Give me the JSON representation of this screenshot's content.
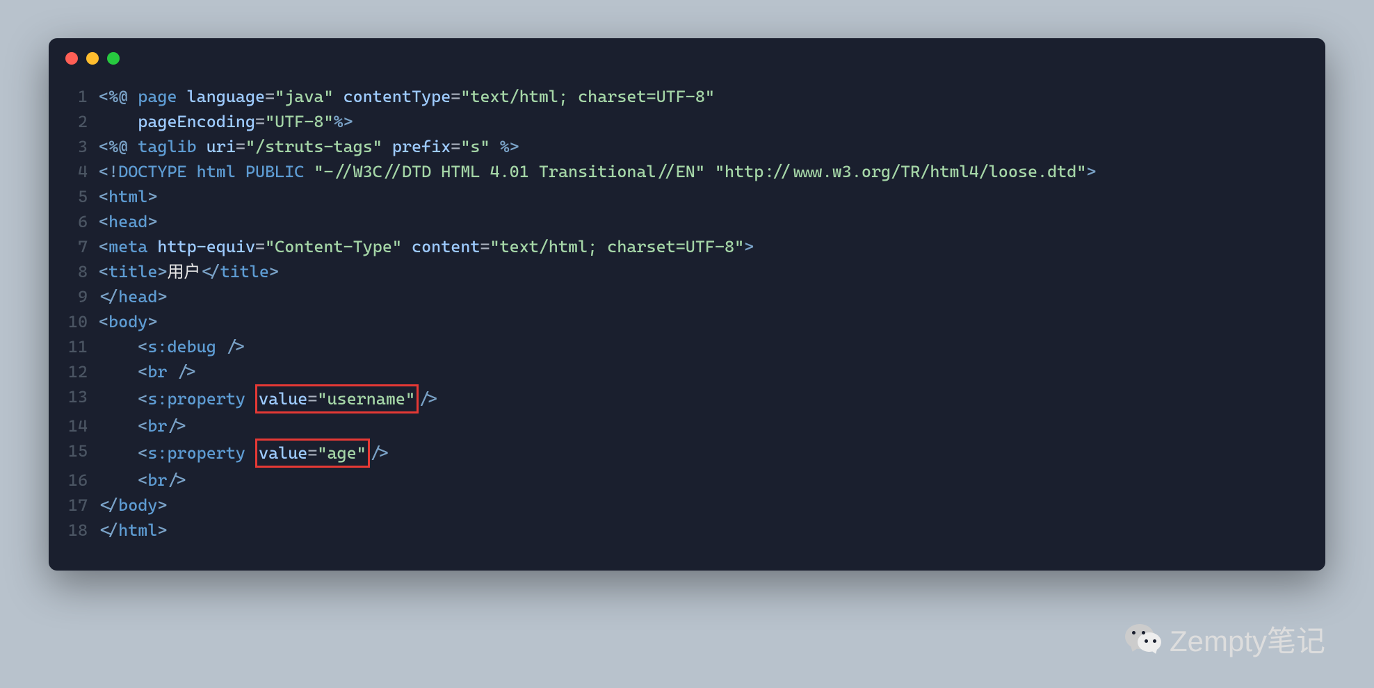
{
  "watermark": "Zempty笔记",
  "lines": [
    {
      "num": "1"
    },
    {
      "num": "2"
    },
    {
      "num": "3"
    },
    {
      "num": "4"
    },
    {
      "num": "5"
    },
    {
      "num": "6"
    },
    {
      "num": "7"
    },
    {
      "num": "8"
    },
    {
      "num": "9"
    },
    {
      "num": "10"
    },
    {
      "num": "11"
    },
    {
      "num": "12"
    },
    {
      "num": "13"
    },
    {
      "num": "14"
    },
    {
      "num": "15"
    },
    {
      "num": "16"
    },
    {
      "num": "17"
    },
    {
      "num": "18"
    }
  ],
  "code": {
    "l1": {
      "open": "<%@",
      "page": " page ",
      "lang_attr": "language",
      "eq1": "=",
      "lang_val": "\"java\"",
      "ct_attr": " contentType",
      "eq2": "=",
      "ct_val": "\"text/html; charset=UTF-8\""
    },
    "l2": {
      "indent": "    ",
      "pe_attr": "pageEncoding",
      "eq": "=",
      "pe_val": "\"UTF-8\"",
      "close": "%>"
    },
    "l3": {
      "open": "<%@",
      "taglib": " taglib ",
      "uri_attr": "uri",
      "eq1": "=",
      "uri_val": "\"/struts-tags\"",
      "prefix_attr": " prefix",
      "eq2": "=",
      "prefix_val": "\"s\"",
      "close": " %>"
    },
    "l4": {
      "open": "<!",
      "doctype": "DOCTYPE ",
      "html": "html ",
      "public": "PUBLIC ",
      "fpi": "\"-//W3C//DTD HTML 4.01 Transitional//EN\"",
      "space": " ",
      "uri": "\"http://www.w3.org/TR/html4/loose.dtd\"",
      "close": ">"
    },
    "l5": {
      "open": "<",
      "tag": "html",
      "close": ">"
    },
    "l6": {
      "open": "<",
      "tag": "head",
      "close": ">"
    },
    "l7": {
      "open": "<",
      "tag": "meta",
      "he_attr": " http-equiv",
      "eq1": "=",
      "he_val": "\"Content-Type\"",
      "c_attr": " content",
      "eq2": "=",
      "c_val": "\"text/html; charset=UTF-8\"",
      "close": ">"
    },
    "l8": {
      "open": "<",
      "tag": "title",
      "close1": ">",
      "text": "用户",
      "open2": "</",
      "tag2": "title",
      "close2": ">"
    },
    "l9": {
      "open": "</",
      "tag": "head",
      "close": ">"
    },
    "l10": {
      "open": "<",
      "tag": "body",
      "close": ">"
    },
    "l11": {
      "indent": "    ",
      "open": "<",
      "tag": "s:debug",
      "close": " />"
    },
    "l12": {
      "indent": "    ",
      "open": "<",
      "tag": "br",
      "close": " />"
    },
    "l13": {
      "indent": "    ",
      "open": "<",
      "tag": "s:property",
      "sp": " ",
      "val_attr": "value",
      "eq": "=",
      "val": "\"username\"",
      "close": "/>"
    },
    "l14": {
      "indent": "    ",
      "open": "<",
      "tag": "br",
      "close": "/>"
    },
    "l15": {
      "indent": "    ",
      "open": "<",
      "tag": "s:property",
      "sp": " ",
      "val_attr": "value",
      "eq": "=",
      "val": "\"age\"",
      "close": "/>"
    },
    "l16": {
      "indent": "    ",
      "open": "<",
      "tag": "br",
      "close": "/>"
    },
    "l17": {
      "open": "</",
      "tag": "body",
      "close": ">"
    },
    "l18": {
      "open": "</",
      "tag": "html",
      "close": ">"
    }
  }
}
